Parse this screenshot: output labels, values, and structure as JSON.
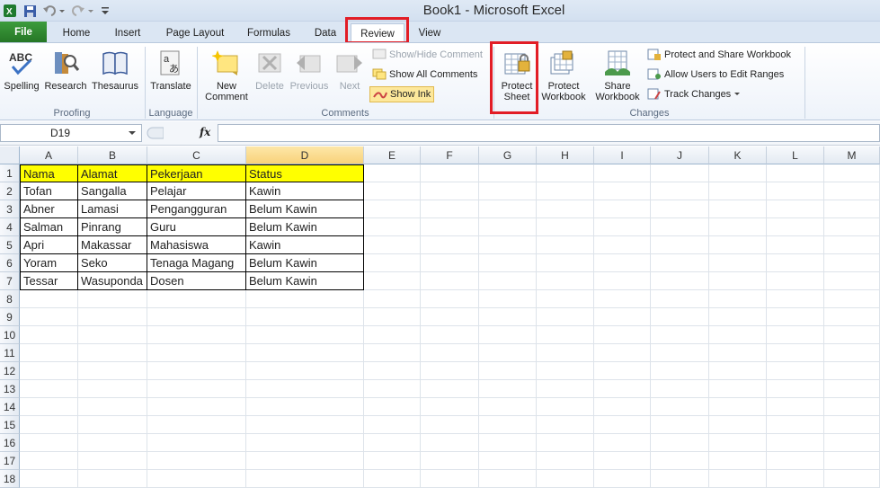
{
  "title_bar": {
    "title": "Book1  -  Microsoft Excel"
  },
  "tabs": [
    "File",
    "Home",
    "Insert",
    "Page Layout",
    "Formulas",
    "Data",
    "Review",
    "View"
  ],
  "ribbon": {
    "proofing": {
      "label": "Proofing",
      "spelling": "Spelling",
      "research": "Research",
      "thesaurus": "Thesaurus"
    },
    "language": {
      "label": "Language",
      "translate": "Translate"
    },
    "comments": {
      "label": "Comments",
      "new_comment_1": "New",
      "new_comment_2": "Comment",
      "delete": "Delete",
      "previous": "Previous",
      "next": "Next",
      "show_hide": "Show/Hide Comment",
      "show_all": "Show All Comments",
      "show_ink": "Show Ink"
    },
    "changes": {
      "label": "Changes",
      "protect_sheet_1": "Protect",
      "protect_sheet_2": "Sheet",
      "protect_workbook_1": "Protect",
      "protect_workbook_2": "Workbook",
      "share_workbook_1": "Share",
      "share_workbook_2": "Workbook",
      "protect_share": "Protect and Share Workbook",
      "allow_users": "Allow Users to Edit Ranges",
      "track_changes": "Track Changes"
    }
  },
  "formula_bar": {
    "name_box": "D19",
    "fx": "fx",
    "value": ""
  },
  "sheet": {
    "columns": [
      "A",
      "B",
      "C",
      "D",
      "E",
      "F",
      "G",
      "H",
      "I",
      "J",
      "K",
      "L",
      "M"
    ],
    "rows": [
      "1",
      "2",
      "3",
      "4",
      "5",
      "6",
      "7",
      "8",
      "9",
      "10",
      "11",
      "12",
      "13",
      "14",
      "15",
      "16",
      "17",
      "18"
    ],
    "headers": [
      "Nama",
      "Alamat",
      "Pekerjaan",
      "Status"
    ],
    "data": [
      [
        "Tofan",
        "Sangalla",
        "Pelajar",
        "Kawin"
      ],
      [
        "Abner",
        "Lamasi",
        "Pengangguran",
        "Belum Kawin"
      ],
      [
        "Salman",
        "Pinrang",
        "Guru",
        "Belum Kawin"
      ],
      [
        "Apri",
        "Makassar",
        "Mahasiswa",
        "Kawin"
      ],
      [
        "Yoram",
        "Seko",
        "Tenaga Magang",
        "Belum Kawin"
      ],
      [
        "Tessar",
        "Wasuponda",
        "Dosen",
        "Belum Kawin"
      ]
    ]
  },
  "colors": {
    "header_fill": "#ffff00",
    "highlight": "#e21d26",
    "file_tab": "#2e862e"
  }
}
